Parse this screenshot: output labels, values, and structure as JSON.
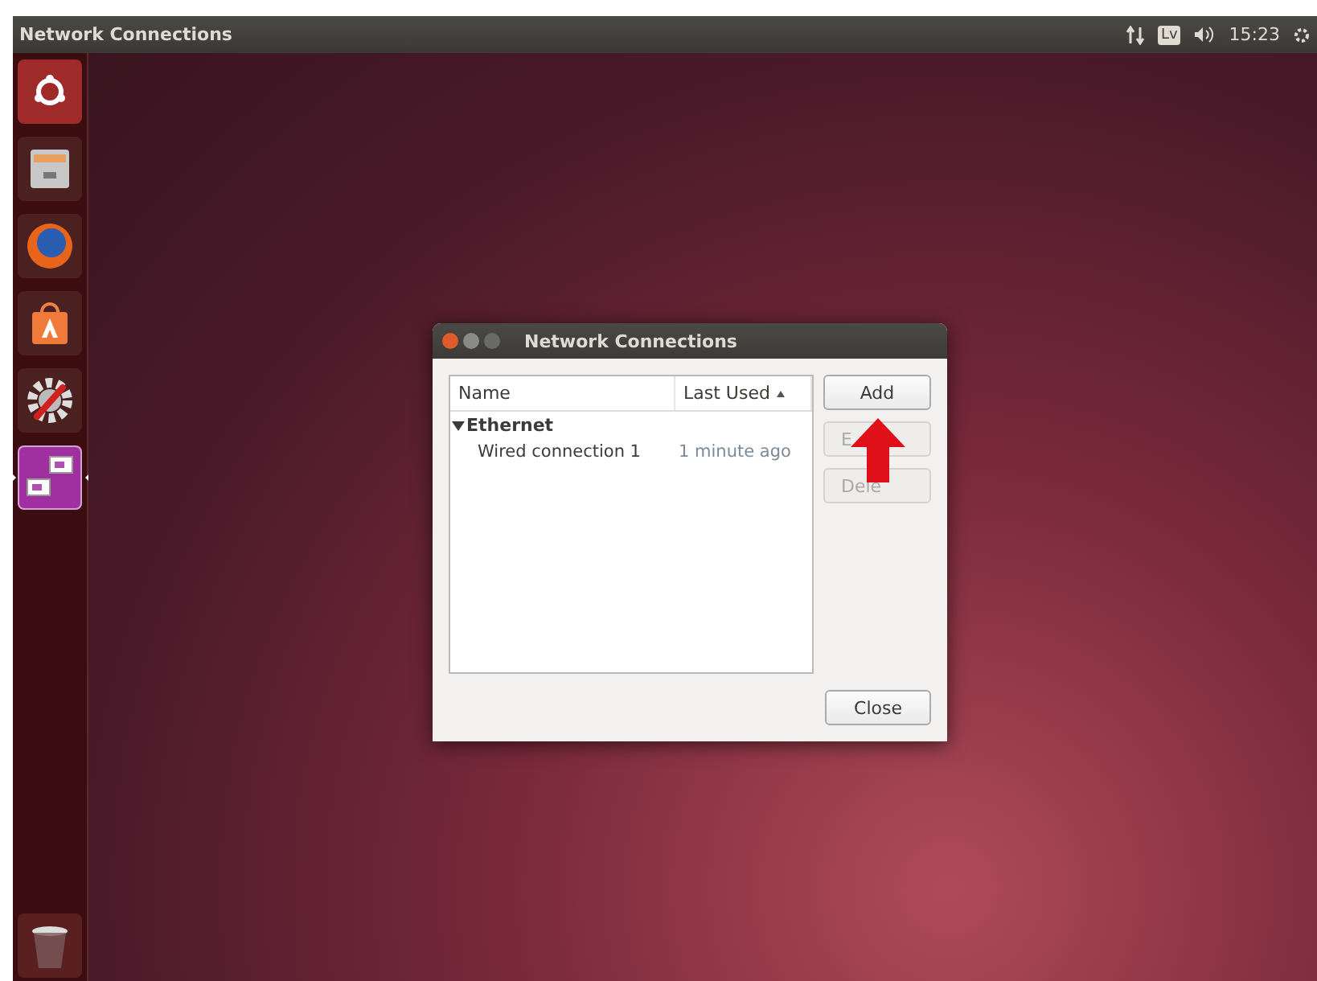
{
  "top_bar": {
    "title": "Network Connections",
    "keyboard_layout": "Lv",
    "time": "15:23"
  },
  "launcher": [
    {
      "kind": "dash",
      "running": false
    },
    {
      "kind": "files",
      "running": false
    },
    {
      "kind": "browser",
      "running": false
    },
    {
      "kind": "store",
      "running": false
    },
    {
      "kind": "settings",
      "running": false
    },
    {
      "kind": "network",
      "running": true
    },
    {
      "kind": "trash",
      "running": false
    }
  ],
  "dialog": {
    "title": "Network Connections",
    "columns": [
      {
        "label": "Name",
        "sorted": false
      },
      {
        "label": "Last Used",
        "sorted": true
      }
    ],
    "groups": [
      {
        "name": "Ethernet",
        "expanded": true,
        "children": [
          {
            "name": "Wired connection 1",
            "last_used": "1 minute ago"
          }
        ]
      }
    ],
    "buttons": [
      {
        "label": "Add",
        "disabled": false
      },
      {
        "label": "E",
        "disabled": true
      },
      {
        "label": "Dele",
        "disabled": true
      }
    ],
    "close_button": "Close"
  }
}
